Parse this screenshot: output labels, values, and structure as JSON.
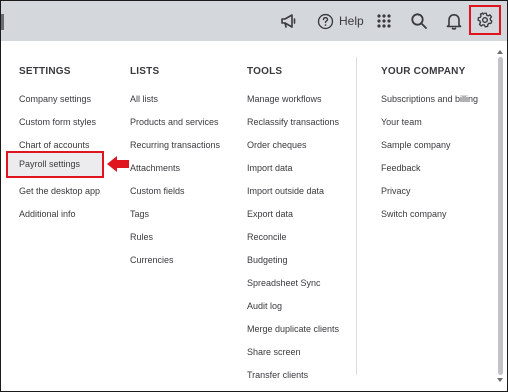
{
  "topbar": {
    "help_label": "Help",
    "icons": [
      "megaphone-icon",
      "help-icon",
      "apps-grid-icon",
      "search-icon",
      "bell-icon",
      "gear-icon"
    ]
  },
  "settings": {
    "heading": "SETTINGS",
    "items": [
      "Company settings",
      "Custom form styles",
      "Chart of accounts",
      "Payroll settings",
      "Get the desktop app",
      "Additional info"
    ]
  },
  "lists": {
    "heading": "LISTS",
    "items": [
      "All lists",
      "Products and services",
      "Recurring transactions",
      "Attachments",
      "Custom fields",
      "Tags",
      "Rules",
      "Currencies"
    ]
  },
  "tools": {
    "heading": "TOOLS",
    "items": [
      "Manage workflows",
      "Reclassify transactions",
      "Order cheques",
      "Import data",
      "Import outside data",
      "Export data",
      "Reconcile",
      "Budgeting",
      "Spreadsheet Sync",
      "Audit log",
      "Merge duplicate clients",
      "Share screen",
      "Transfer clients"
    ]
  },
  "company": {
    "heading": "YOUR COMPANY",
    "items": [
      "Subscriptions and billing",
      "Your team",
      "Sample company",
      "Feedback",
      "Privacy",
      "Switch company"
    ]
  },
  "colors": {
    "highlight_border": "#e0141e",
    "topbar_bg": "#d4d7dc",
    "text": "#393a3d"
  }
}
